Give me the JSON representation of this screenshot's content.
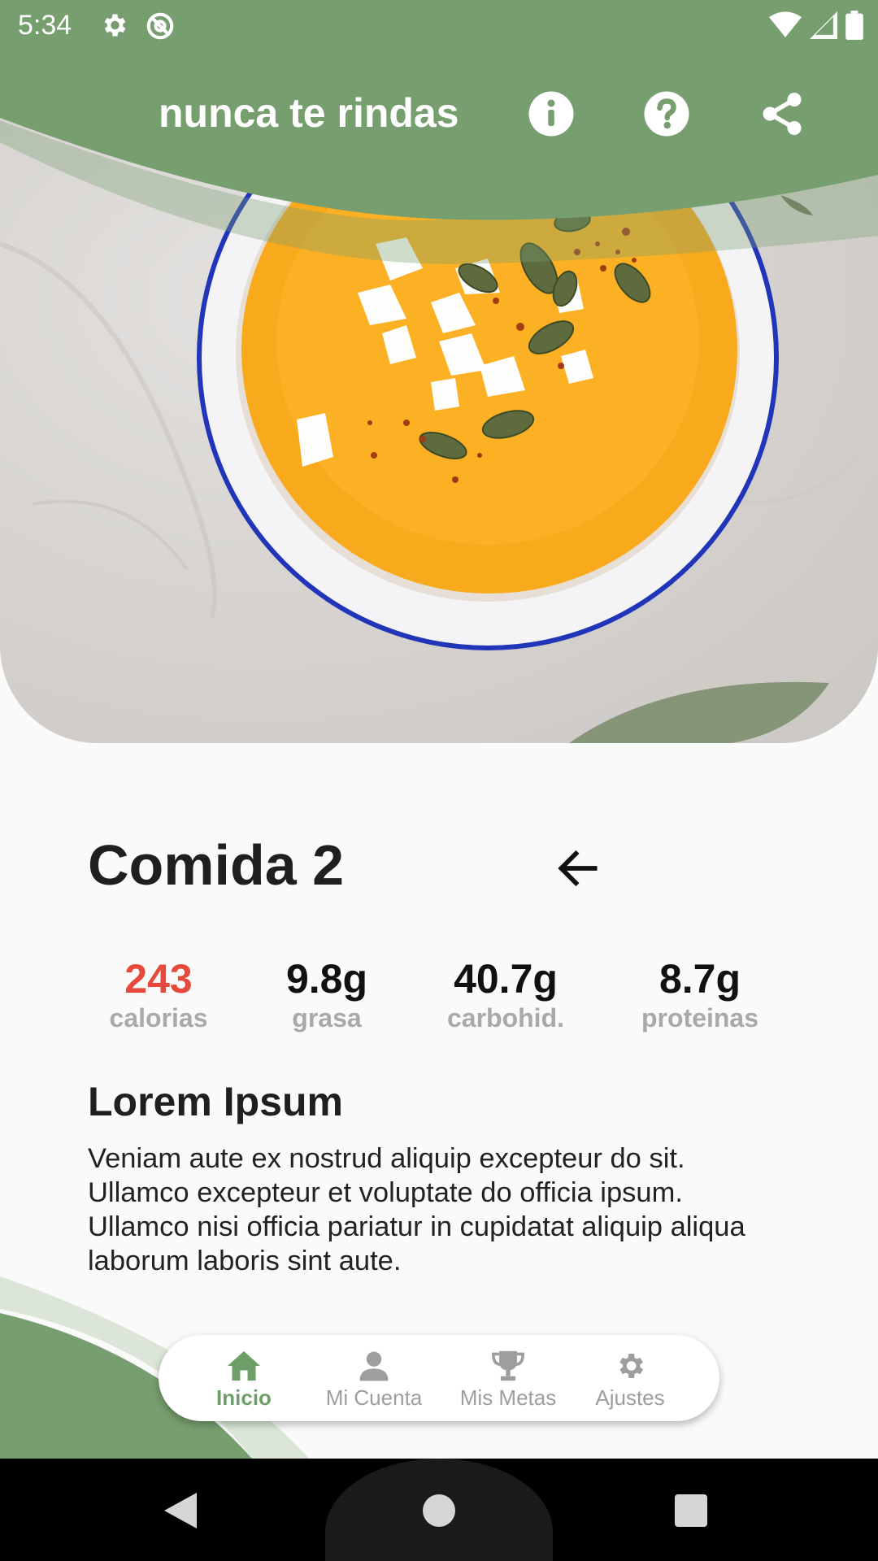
{
  "status_bar": {
    "time": "5:34"
  },
  "header": {
    "title": "nunca te rindas",
    "color": "#779e6f",
    "buttons": [
      {
        "name": "info-icon"
      },
      {
        "name": "help-icon"
      },
      {
        "name": "share-icon"
      }
    ]
  },
  "meal": {
    "title": "Comida 2"
  },
  "nutrition": [
    {
      "value": "243",
      "label": "calorias",
      "accent": "#e64a3c"
    },
    {
      "value": "9.8g",
      "label": "grasa"
    },
    {
      "value": "40.7g",
      "label": "carbohid."
    },
    {
      "value": "8.7g",
      "label": "proteinas"
    }
  ],
  "description": {
    "title": "Lorem Ipsum",
    "text": "Veniam aute ex nostrud aliquip excepteur do sit. Ullamco excepteur et voluptate do officia ipsum. Ullamco nisi officia pariatur in cupidatat aliquip aliqua laborum laboris sint aute."
  },
  "bottom_nav": {
    "items": [
      {
        "label": "Inicio",
        "icon": "home-icon",
        "active": true
      },
      {
        "label": "Mi Cuenta",
        "icon": "user-icon",
        "active": false
      },
      {
        "label": "Mis Metas",
        "icon": "trophy-icon",
        "active": false
      },
      {
        "label": "Ajustes",
        "icon": "gear-icon",
        "active": false
      }
    ],
    "active_color": "#6f9f69"
  }
}
